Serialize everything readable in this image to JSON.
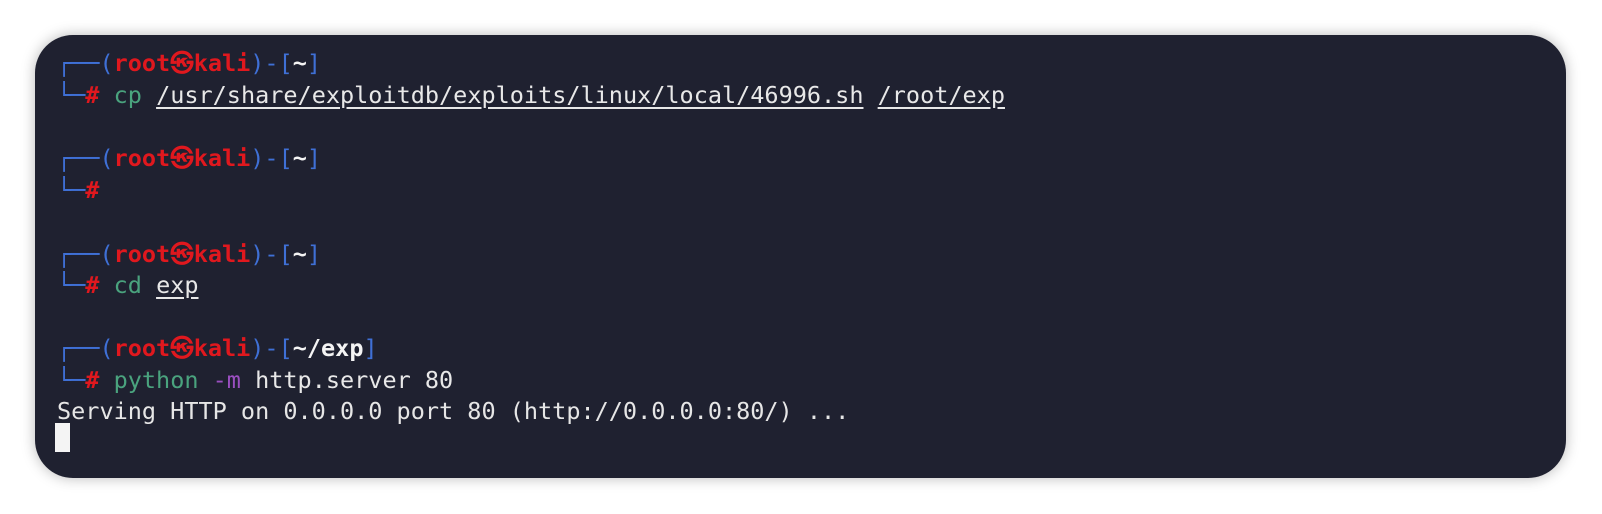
{
  "prompt": {
    "user": "root",
    "separator": "㉿",
    "host": "kali",
    "corner_top": "┌──(",
    "mid": ")-[",
    "close_bracket": "]",
    "corner_bottom": "└─",
    "hash": "#"
  },
  "blocks": [
    {
      "dir": "~",
      "command": "cp",
      "args": [
        "/usr/share/exploitdb/exploits/linux/local/46996.sh",
        "/root/exp"
      ]
    },
    {
      "dir": "~",
      "command": "",
      "args": []
    },
    {
      "dir": "~",
      "command": "cd",
      "args": [
        "exp"
      ]
    },
    {
      "dir": "~/exp",
      "command": "python",
      "flag": "-m",
      "args": [
        "http.server 80"
      ]
    }
  ],
  "output": "Serving HTTP on 0.0.0.0 port 80 (http://0.0.0.0:80/) ...",
  "colors": {
    "background": "#1f2130",
    "prompt_blue": "#3f70d6",
    "prompt_red": "#e0181e",
    "command_green": "#4aa37e",
    "flag_purple": "#9a4fc0"
  }
}
